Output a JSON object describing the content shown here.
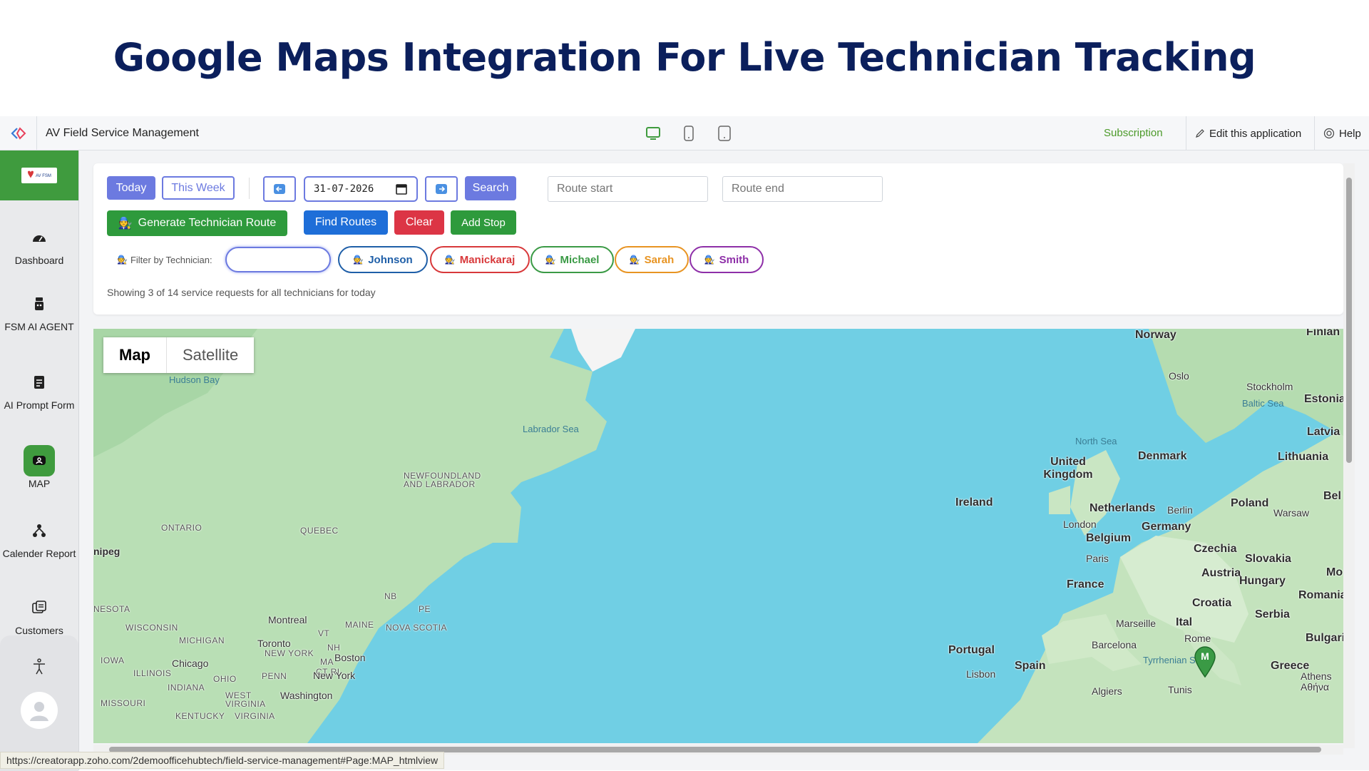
{
  "banner": {
    "title": "Google Maps Integration For Live Technician Tracking"
  },
  "topbar": {
    "app_name": "AV Field Service Management",
    "subscription": "Subscription",
    "edit": "Edit this application",
    "help": "Help"
  },
  "sidebar": {
    "logo_text": "AV Field Service Management",
    "items": [
      {
        "label": "Dashboard",
        "icon": "dashboard-icon"
      },
      {
        "label": "FSM AI AGENT",
        "icon": "robot-icon"
      },
      {
        "label": "AI Prompt Form",
        "icon": "form-icon"
      },
      {
        "label": "MAP",
        "icon": "map-icon",
        "active": true
      },
      {
        "label": "Calender Report",
        "icon": "tree-icon"
      },
      {
        "label": "Customers",
        "icon": "customers-icon"
      }
    ]
  },
  "controls": {
    "today": "Today",
    "this_week": "This Week",
    "date_value": "31-07-2026",
    "search": "Search",
    "route_start_placeholder": "Route start",
    "route_end_placeholder": "Route end",
    "generate": "Generate Technician Route",
    "find_routes": "Find Routes",
    "clear": "Clear",
    "add_stop": "Add Stop",
    "filter_label": "Filter by Technician:",
    "technicians": [
      {
        "name": "Johnson",
        "color": "#1f5fa8"
      },
      {
        "name": "Manickaraj",
        "color": "#d8383a"
      },
      {
        "name": "Michael",
        "color": "#3a9a45"
      },
      {
        "name": "Sarah",
        "color": "#e89422"
      },
      {
        "name": "Smith",
        "color": "#8e2fa8"
      }
    ],
    "status_text": "Showing 3 of 14 service requests for all technicians for today"
  },
  "map": {
    "tab_map": "Map",
    "tab_satellite": "Satellite",
    "labels": {
      "hudson_bay": "Hudson Bay",
      "labrador_sea": "Labrador Sea",
      "newfoundland": "NEWFOUNDLAND AND LABRADOR",
      "ontario": "ONTARIO",
      "quebec": "QUEBEC",
      "winnipeg": "nipeg",
      "nb": "NB",
      "pe": "PE",
      "montreal": "Montreal",
      "vt": "VT",
      "maine": "MAINE",
      "nova_scotia": "NOVA SCOTIA",
      "nesota": "NESOTA",
      "wisconsin": "WISCONSIN",
      "michigan": "MICHIGAN",
      "toronto": "Toronto",
      "new_york_state": "NEW YORK",
      "nh": "NH",
      "iowa": "IOWA",
      "chicago": "Chicago",
      "ma": "MA",
      "boston": "Boston",
      "ct_ri": "CT RI",
      "illinois": "ILLINOIS",
      "ohio": "OHIO",
      "penn": "PENN",
      "new_york": "New York",
      "indiana": "INDIANA",
      "missouri": "MISSOURI",
      "west_virginia": "WEST VIRGINIA",
      "washington": "Washington",
      "kentucky": "KENTUCKY",
      "virginia": "VIRGINIA",
      "norway": "Norway",
      "finland": "Finlan",
      "oslo": "Oslo",
      "stockholm": "Stockholm",
      "baltic_sea": "Baltic Sea",
      "estonia": "Estonia",
      "north_sea": "North Sea",
      "latvia": "Latvia",
      "denmark": "Denmark",
      "lithuania": "Lithuania",
      "united_kingdom": "United Kingdom",
      "ireland": "Ireland",
      "netherlands": "Netherlands",
      "berlin": "Berlin",
      "poland": "Poland",
      "belarus": "Bel",
      "warsaw": "Warsaw",
      "london": "London",
      "germany": "Germany",
      "belgium": "Belgium",
      "czechia": "Czechia",
      "paris": "Paris",
      "slovakia": "Slovakia",
      "moldova": "Mo",
      "austria": "Austria",
      "hungary": "Hungary",
      "france": "France",
      "romania": "Romania",
      "croatia": "Croatia",
      "serbia": "Serbia",
      "marseille": "Marseille",
      "italy": "Ital",
      "rome": "Rome",
      "bulgaria": "Bulgaria",
      "portugal": "Portugal",
      "barcelona": "Barcelona",
      "spain": "Spain",
      "tyrrhenian_sea": "Tyrrhenian Sea",
      "greece": "Greece",
      "lisbon": "Lisbon",
      "athens": "Athens Αθήνα",
      "algiers": "Algiers",
      "tunis": "Tunis"
    },
    "marker_letter": "M",
    "marker_color": "#3a9a45"
  },
  "browser_status": "https://creatorapp.zoho.com/2demoofficehubtech/field-service-management#Page:MAP_htmlview"
}
